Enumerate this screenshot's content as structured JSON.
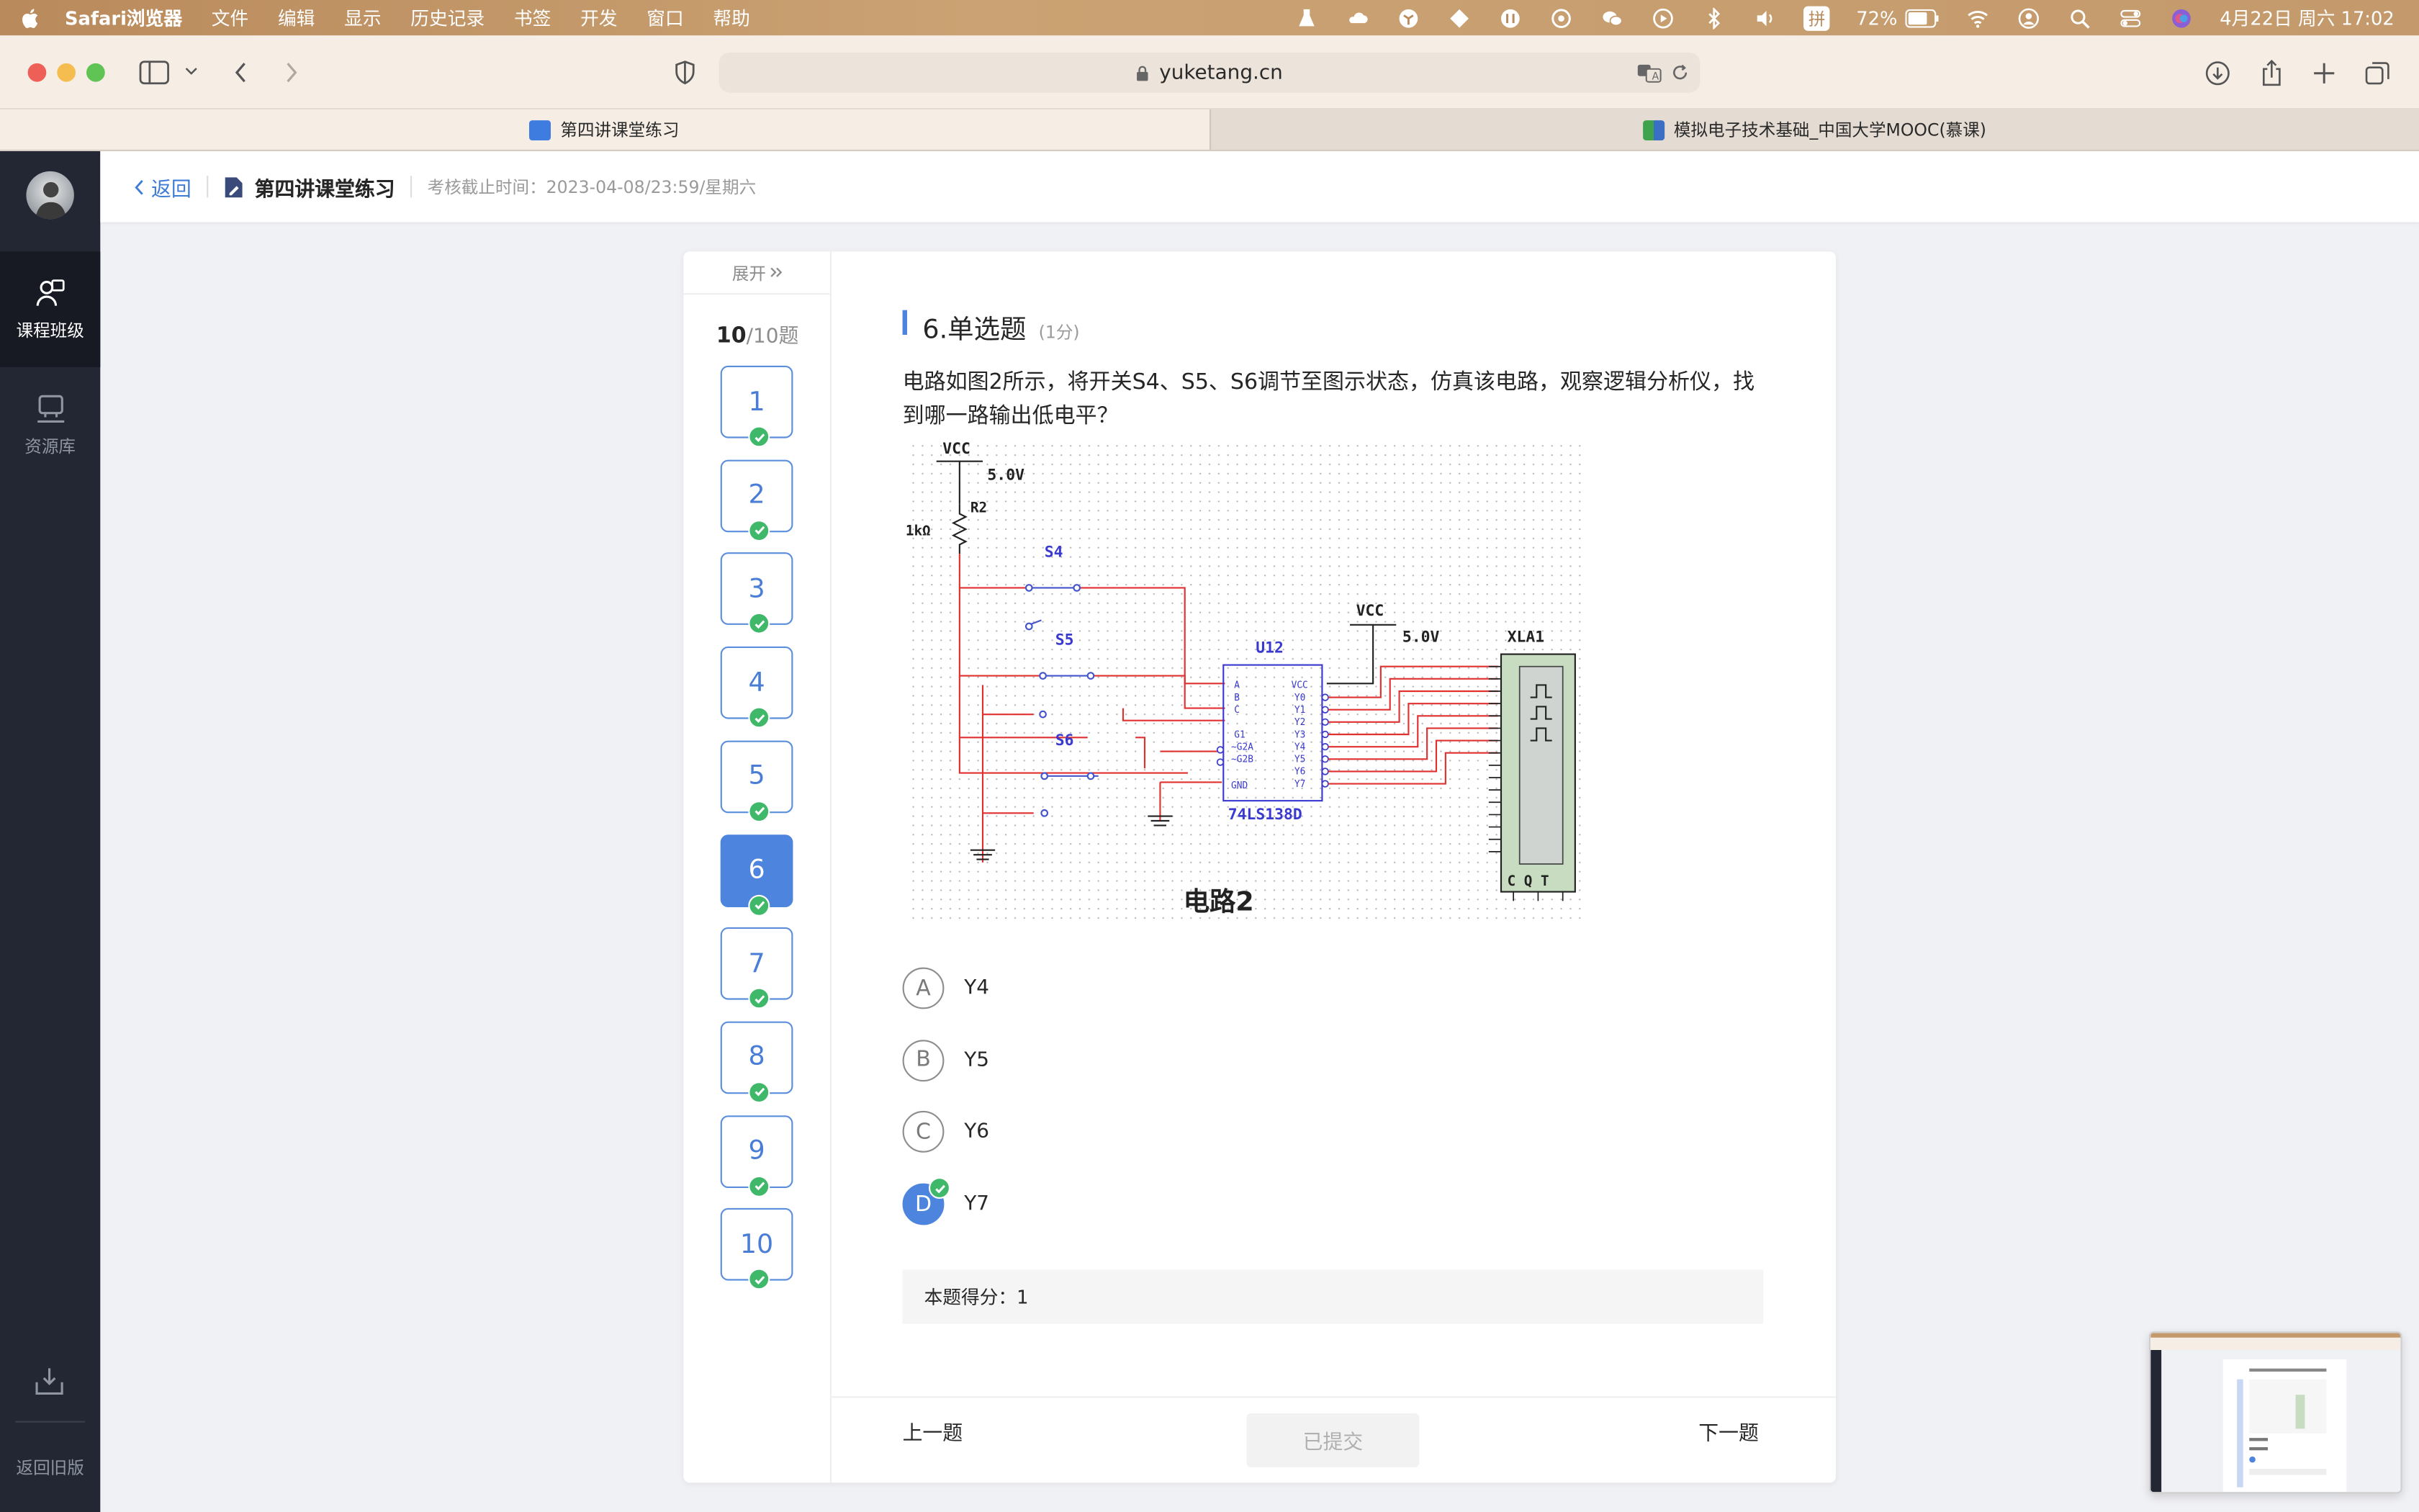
{
  "menubar": {
    "app_name": "Safari浏览器",
    "items": [
      "文件",
      "编辑",
      "显示",
      "历史记录",
      "书签",
      "开发",
      "窗口",
      "帮助"
    ],
    "input_method": "拼",
    "battery": "72%",
    "datetime": "4月22日 周六  17:02"
  },
  "browser": {
    "url": "yuketang.cn",
    "tabs": [
      {
        "label": "第四讲课堂练习",
        "active": true
      },
      {
        "label": "模拟电子技术基础_中国大学MOOC(慕课)",
        "active": false
      }
    ]
  },
  "sidebar": {
    "items": [
      {
        "label": "课程班级",
        "icon": "class-icon"
      },
      {
        "label": "资源库",
        "icon": "library-icon"
      }
    ],
    "bottom_label": "返回旧版"
  },
  "header": {
    "back_label": "返回",
    "title": "第四讲课堂练习",
    "deadline": "考核截止时间：2023-04-08/23:59/星期六"
  },
  "question_nav": {
    "expand_label": "展开",
    "answered": "10",
    "total": "/10题",
    "numbers": [
      "1",
      "2",
      "3",
      "4",
      "5",
      "6",
      "7",
      "8",
      "9",
      "10"
    ],
    "current": "6"
  },
  "question": {
    "title": "6.单选题",
    "points": "(1分)",
    "text": "电路如图2所示，将开关S4、S5、S6调节至图示状态，仿真该电路，观察逻辑分析仪，找到哪一路输出低电平？",
    "figure": {
      "caption": "电路2",
      "labels": {
        "vcc": "VCC",
        "v5": "5.0V",
        "r2": "R2",
        "r_val": "1kΩ",
        "s4": "S4",
        "s5": "S5",
        "s6": "S6",
        "u12": "U12",
        "chip": "74LS138D",
        "xla": "XLA1",
        "cqt": "C  Q  T"
      }
    },
    "options": [
      {
        "letter": "A",
        "text": "Y4",
        "selected": false
      },
      {
        "letter": "B",
        "text": "Y5",
        "selected": false
      },
      {
        "letter": "C",
        "text": "Y6",
        "selected": false
      },
      {
        "letter": "D",
        "text": "Y7",
        "selected": true
      }
    ],
    "score_text": "本题得分：1"
  },
  "footer": {
    "prev": "上一题",
    "submitted": "已提交",
    "next": "下一题"
  },
  "colors": {
    "accent": "#4d84de",
    "correct": "#3fb86a",
    "sidebar": "#232733"
  }
}
